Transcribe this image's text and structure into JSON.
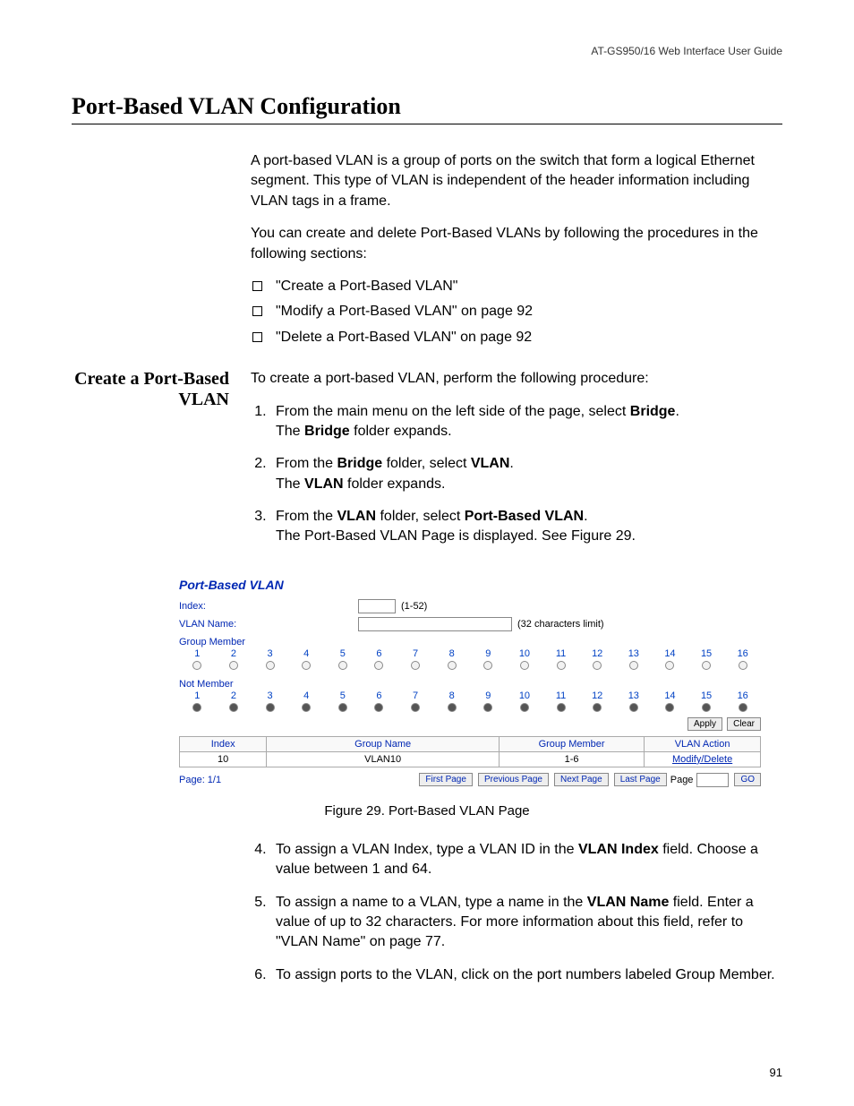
{
  "header": {
    "doc": "AT-GS950/16  Web Interface User Guide"
  },
  "title": "Port-Based VLAN Configuration",
  "intro": {
    "p1": "A port-based VLAN is a group of ports on the switch that form a logical Ethernet segment. This type of VLAN is independent of the header information including VLAN tags in a frame.",
    "p2": "You can create and delete Port-Based VLANs by following the procedures in the following sections:"
  },
  "bullets": [
    "\"Create a Port-Based VLAN\"",
    "\"Modify a Port-Based VLAN\" on page 92",
    "\"Delete a Port-Based VLAN\" on page 92"
  ],
  "side": {
    "heading": "Create a Port-Based VLAN"
  },
  "procIntro": "To create a port-based VLAN, perform the following procedure:",
  "steps1": {
    "s1a": "From the main menu on the left side of the page, select ",
    "s1b": "Bridge",
    "s1c": ".",
    "s1d": "The ",
    "s1e": "Bridge",
    "s1f": " folder expands.",
    "s2a": "From the ",
    "s2b": "Bridge",
    "s2c": " folder, select ",
    "s2d": "VLAN",
    "s2e": ".",
    "s2f": "The ",
    "s2g": "VLAN",
    "s2h": " folder expands.",
    "s3a": "From the ",
    "s3b": "VLAN",
    "s3c": " folder, select ",
    "s3d": "Port-Based VLAN",
    "s3e": ".",
    "s3f": "The Port-Based VLAN Page is displayed. See Figure 29."
  },
  "figure": {
    "title": "Port-Based VLAN",
    "indexLabel": "Index:",
    "indexHint": "(1-52)",
    "nameLabel": "VLAN Name:",
    "nameHint": "(32 characters limit)",
    "groupMember": "Group Member",
    "notMember": "Not Member",
    "ports": [
      "1",
      "2",
      "3",
      "4",
      "5",
      "6",
      "7",
      "8",
      "9",
      "10",
      "11",
      "12",
      "13",
      "14",
      "15",
      "16"
    ],
    "applyBtn": "Apply",
    "clearBtn": "Clear",
    "sumHeaders": {
      "idx": "Index",
      "gname": "Group Name",
      "gmem": "Group Member",
      "vact": "VLAN Action"
    },
    "sumRow": {
      "idx": "10",
      "gname": "VLAN10",
      "gmem": "1-6",
      "vact": "Modify/Delete"
    },
    "pageLabel": "Page:  1/1",
    "firstBtn": "First Page",
    "prevBtn": "Previous Page",
    "nextBtn": "Next Page",
    "lastBtn": "Last Page",
    "pageWord": "Page",
    "goBtn": "GO"
  },
  "caption": "Figure 29. Port-Based VLAN Page",
  "steps2": {
    "s4a": "To assign a VLAN Index, type a VLAN ID in the ",
    "s4b": "VLAN Index",
    "s4c": " field. Choose a value between 1 and 64.",
    "s5a": "To assign a name to a VLAN, type a name in the ",
    "s5b": "VLAN Name",
    "s5c": " field. Enter a value of up to 32 characters. For more information about this field, refer to \"VLAN Name\" on page 77.",
    "s6": "To assign ports to the VLAN, click on the port numbers labeled Group Member."
  },
  "pageNumber": "91"
}
